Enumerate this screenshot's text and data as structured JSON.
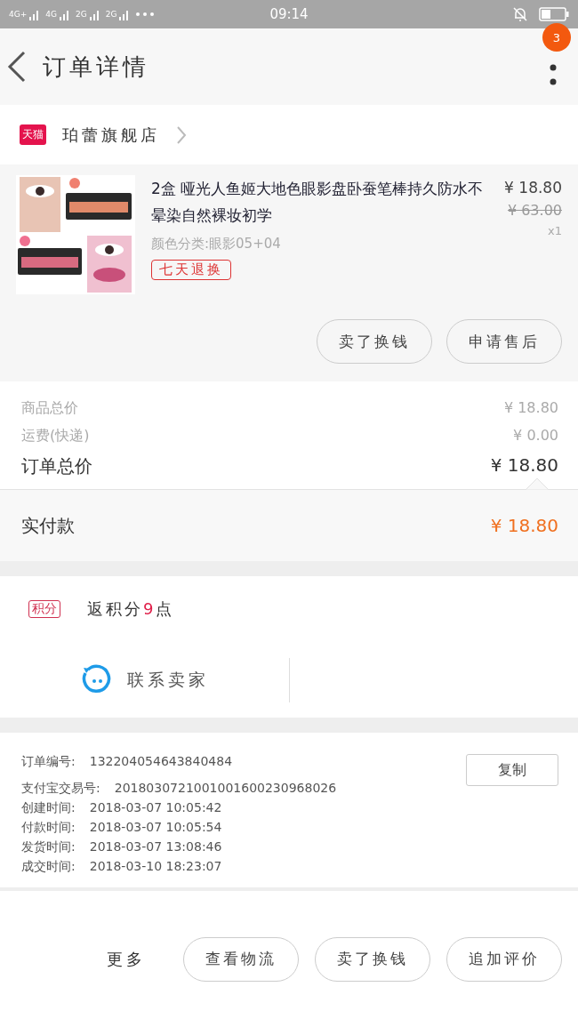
{
  "status_bar": {
    "network_labels": [
      "4G+",
      "4G",
      "2G",
      "2G"
    ],
    "time": "09:14"
  },
  "header": {
    "title": "订单详情",
    "badge": "3"
  },
  "shop": {
    "badge": "天猫",
    "name": "珀蕾旗舰店"
  },
  "product": {
    "kind": "picture",
    "title": "2盒 哑光人鱼姬大地色眼影盘卧蚕笔棒持久防水不晕染自然裸妆初学",
    "price": "¥ 18.80",
    "original_price": "¥ 63.00",
    "variant": "颜色分类:眼影05+04",
    "quantity": "x1",
    "tag": "七天退换",
    "buttons": [
      "卖了换钱",
      "申请售后"
    ]
  },
  "totals": [
    {
      "kind": "minor",
      "label": "商品总价",
      "value": "¥ 18.80"
    },
    {
      "kind": "minor",
      "label": "运费(快递)",
      "value": "¥ 0.00"
    },
    {
      "kind": "total",
      "label": "订单总价",
      "value": "¥ 18.80"
    }
  ],
  "payment": {
    "label": "实付款",
    "value": "¥ 18.80"
  },
  "points": {
    "badge": "积分",
    "prefix": "返积分",
    "highlight": "9",
    "suffix": "点"
  },
  "contact": {
    "label": "联系卖家"
  },
  "order_info": {
    "copy_button": "复制",
    "rows": [
      {
        "label": "订单编号:",
        "value": "132204054643840484"
      },
      {
        "label": "支付宝交易号:",
        "value": "2018030721001001600230968026"
      },
      {
        "label": "创建时间:",
        "value": "2018-03-07 10:05:42"
      },
      {
        "label": "付款时间:",
        "value": "2018-03-07 10:05:54"
      },
      {
        "label": "发货时间:",
        "value": "2018-03-07 13:08:46"
      },
      {
        "label": "成交时间:",
        "value": "2018-03-10 18:23:07"
      }
    ]
  },
  "footer": {
    "more": "更多",
    "buttons": [
      "查看物流",
      "卖了换钱",
      "追加评价"
    ]
  }
}
